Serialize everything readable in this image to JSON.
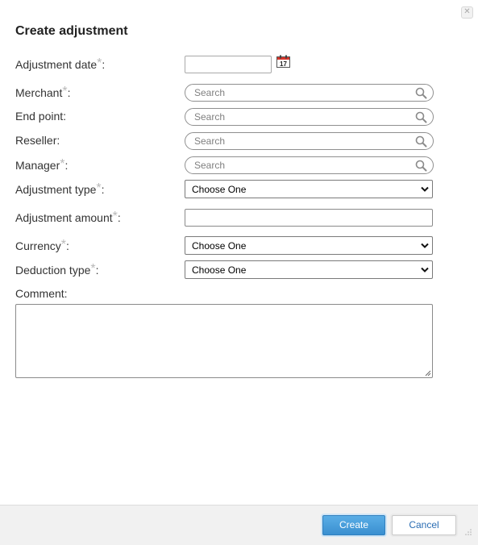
{
  "dialog": {
    "title": "Create adjustment",
    "close_glyph": "✕",
    "required_mark": "*"
  },
  "form": {
    "adjustment_date": {
      "label": "Adjustment date",
      "required": true,
      "suffix": ":",
      "value": "",
      "icon": "calendar-icon",
      "calendar_day": "17"
    },
    "merchant": {
      "label": "Merchant",
      "required": true,
      "suffix": ":",
      "placeholder": "Search",
      "icon": "search-icon"
    },
    "end_point": {
      "label": "End point:",
      "required": false,
      "placeholder": "Search",
      "icon": "search-icon"
    },
    "reseller": {
      "label": "Reseller:",
      "required": false,
      "placeholder": "Search",
      "icon": "search-icon"
    },
    "manager": {
      "label": "Manager",
      "required": true,
      "suffix": ":",
      "placeholder": "Search",
      "icon": "search-icon"
    },
    "adjustment_type": {
      "label": "Adjustment type",
      "required": true,
      "suffix": ":",
      "selected": "Choose One"
    },
    "adjustment_amount": {
      "label": "Adjustment amount",
      "required": true,
      "suffix": ":",
      "value": ""
    },
    "currency": {
      "label": "Currency",
      "required": true,
      "suffix": ":",
      "selected": "Choose One"
    },
    "deduction_type": {
      "label": "Deduction type",
      "required": true,
      "suffix": ":",
      "selected": "Choose One"
    },
    "comment": {
      "label": "Comment:",
      "value": ""
    }
  },
  "footer": {
    "create_label": "Create",
    "cancel_label": "Cancel"
  },
  "colors": {
    "primary_button": "#3a8fd0",
    "link_text": "#2a6db3",
    "required_mark": "#b8b8b8",
    "calendar_accent": "#d9352b"
  }
}
